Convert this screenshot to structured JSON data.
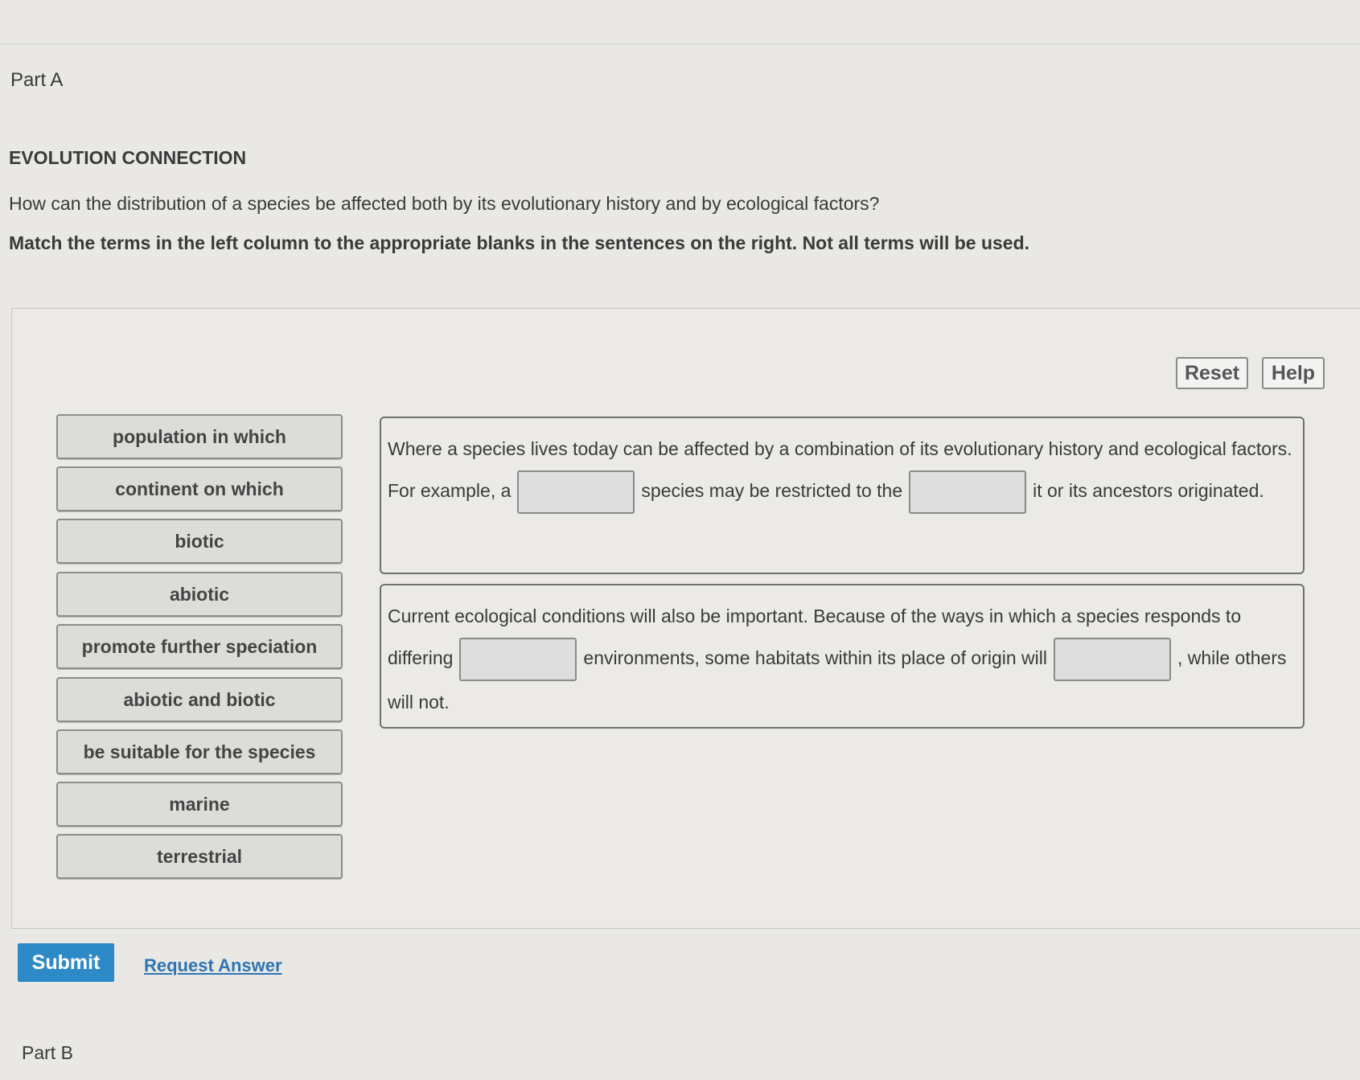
{
  "part_a": "Part A",
  "heading": "EVOLUTION CONNECTION",
  "question": "How can the distribution of a species be affected both by its evolutionary history and by ecological factors?",
  "instructions": "Match the terms in the left column to the appropriate blanks in the sentences on the right. Not all terms will be used.",
  "buttons": {
    "reset": "Reset",
    "help": "Help",
    "submit": "Submit",
    "request_answer": "Request Answer"
  },
  "terms": [
    "population in which",
    "continent on which",
    "biotic",
    "abiotic",
    "promote further speciation",
    "abiotic and biotic",
    "be suitable for the species",
    "marine",
    "terrestrial"
  ],
  "sentence1": {
    "part1": "Where a species lives today can be affected by a combination of its evolutionary history and ecological factors. For example, a",
    "part2": "species may be restricted to the",
    "part3": "it or its ancestors originated."
  },
  "sentence2": {
    "part1": "Current ecological conditions will also be important. Because of the ways in which a species responds to differing",
    "part2": "environments, some habitats within its place of origin will",
    "part3": ", while others will not."
  },
  "part_b": "Part B",
  "colors": {
    "submit": "#2e8ac7",
    "link": "#2f74b5"
  }
}
